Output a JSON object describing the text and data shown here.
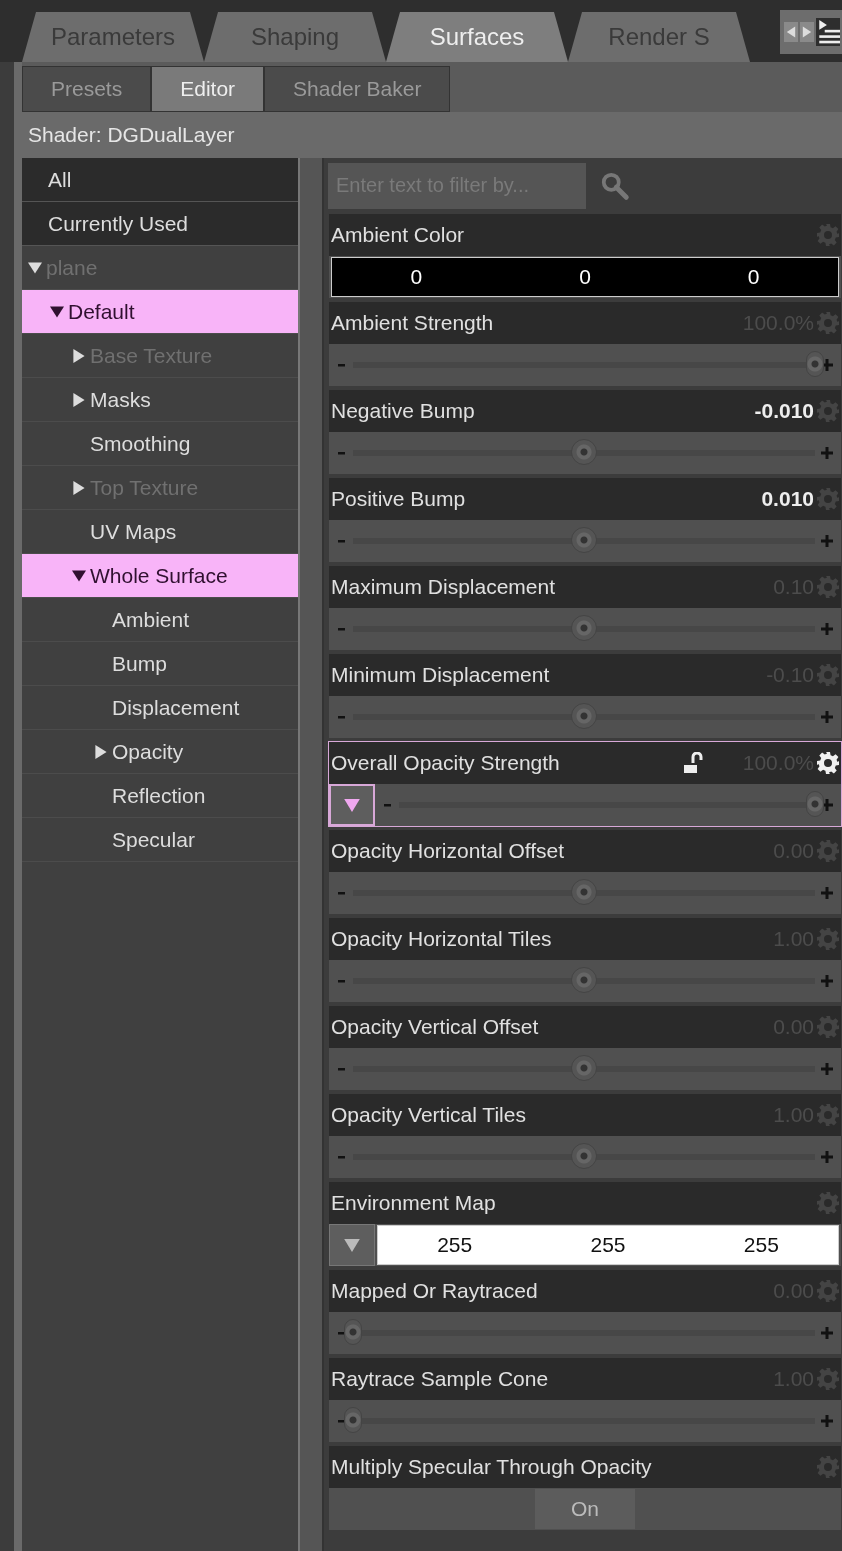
{
  "tabs": [
    {
      "label": "Parameters",
      "selected": false
    },
    {
      "label": "Shaping",
      "selected": false
    },
    {
      "label": "Surfaces",
      "selected": true
    },
    {
      "label": "Render S",
      "selected": false
    }
  ],
  "subtabs": [
    {
      "label": "Presets",
      "selected": false
    },
    {
      "label": "Editor",
      "selected": true
    },
    {
      "label": "Shader Baker",
      "selected": false
    }
  ],
  "shader_label": "Shader: DGDualLayer",
  "sidebar": {
    "filters": [
      {
        "label": "All"
      },
      {
        "label": "Currently Used"
      }
    ],
    "tree": [
      {
        "label": "plane",
        "expanded": true,
        "disabled": true,
        "selected": false,
        "children": [
          {
            "label": "Default",
            "expanded": true,
            "disabled": false,
            "selected": true,
            "children": [
              {
                "label": "Base Texture",
                "expanded": false,
                "disabled": true,
                "selected": false
              },
              {
                "label": "Masks",
                "expanded": false,
                "disabled": false,
                "selected": false
              },
              {
                "label": "Smoothing",
                "disabled": false,
                "selected": false
              },
              {
                "label": "Top Texture",
                "expanded": false,
                "disabled": true,
                "selected": false
              },
              {
                "label": "UV Maps",
                "disabled": false,
                "selected": false
              },
              {
                "label": "Whole Surface",
                "expanded": true,
                "disabled": false,
                "selected": true,
                "children": [
                  {
                    "label": "Ambient",
                    "disabled": false,
                    "selected": false
                  },
                  {
                    "label": "Bump",
                    "disabled": false,
                    "selected": false
                  },
                  {
                    "label": "Displacement",
                    "disabled": false,
                    "selected": false
                  },
                  {
                    "label": "Opacity",
                    "expanded": false,
                    "disabled": false,
                    "selected": false
                  },
                  {
                    "label": "Reflection",
                    "disabled": false,
                    "selected": false
                  },
                  {
                    "label": "Specular",
                    "disabled": false,
                    "selected": false
                  }
                ]
              }
            ]
          }
        ]
      }
    ]
  },
  "filter_field": {
    "placeholder": "Enter text to filter by..."
  },
  "properties": [
    {
      "kind": "color",
      "label": "Ambient Color",
      "values": [
        "0",
        "0",
        "0"
      ],
      "map_button": false,
      "selected": false
    },
    {
      "kind": "slider",
      "label": "Ambient Strength",
      "value": "100.0%",
      "modified": false,
      "level": 1,
      "map_button": false,
      "selected": false
    },
    {
      "kind": "slider",
      "label": "Negative Bump",
      "value": "-0.010",
      "modified": true,
      "level": 0.5,
      "map_button": false,
      "selected": false
    },
    {
      "kind": "slider",
      "label": "Positive Bump",
      "value": "0.010",
      "modified": true,
      "level": 0.5,
      "map_button": false,
      "selected": false
    },
    {
      "kind": "slider",
      "label": "Maximum Displacement",
      "value": "0.10",
      "modified": false,
      "level": 0.5,
      "map_button": false,
      "selected": false
    },
    {
      "kind": "slider",
      "label": "Minimum Displacement",
      "value": "-0.10",
      "modified": false,
      "level": 0.5,
      "map_button": false,
      "selected": false
    },
    {
      "kind": "slider",
      "label": "Overall Opacity Strength",
      "value": "100.0%",
      "modified": false,
      "level": 1,
      "map_button": true,
      "locked": false,
      "selected": true
    },
    {
      "kind": "slider",
      "label": "Opacity Horizontal Offset",
      "value": "0.00",
      "modified": false,
      "level": 0.5,
      "map_button": false,
      "selected": false
    },
    {
      "kind": "slider",
      "label": "Opacity Horizontal Tiles",
      "value": "1.00",
      "modified": false,
      "level": 0.5,
      "map_button": false,
      "selected": false
    },
    {
      "kind": "slider",
      "label": "Opacity Vertical Offset",
      "value": "0.00",
      "modified": false,
      "level": 0.5,
      "map_button": false,
      "selected": false
    },
    {
      "kind": "slider",
      "label": "Opacity Vertical Tiles",
      "value": "1.00",
      "modified": false,
      "level": 0.5,
      "map_button": false,
      "selected": false
    },
    {
      "kind": "color",
      "label": "Environment Map",
      "values": [
        "255",
        "255",
        "255"
      ],
      "map_button": true,
      "selected": false
    },
    {
      "kind": "slider",
      "label": "Mapped Or Raytraced",
      "value": "0.00",
      "modified": false,
      "level": 0,
      "map_button": false,
      "selected": false
    },
    {
      "kind": "slider",
      "label": "Raytrace Sample Cone",
      "value": "1.00",
      "modified": false,
      "level": 0,
      "map_button": false,
      "selected": false
    },
    {
      "kind": "toggle",
      "label": "Multiply Specular Through Opacity",
      "button_label": "On",
      "on": true,
      "selected": false
    }
  ]
}
